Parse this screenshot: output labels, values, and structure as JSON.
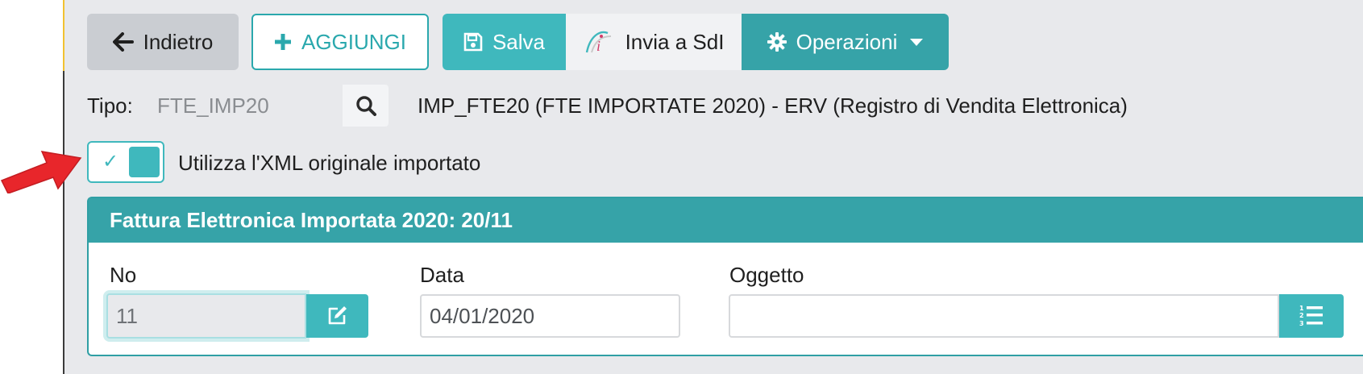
{
  "toolbar": {
    "back_label": "Indietro",
    "add_label": "AGGIUNGI",
    "save_label": "Salva",
    "send_label": "Invia a SdI",
    "operations_label": "Operazioni"
  },
  "tipo": {
    "label": "Tipo:",
    "value": "FTE_IMP20",
    "description": "IMP_FTE20 (FTE IMPORTATE 2020) - ERV (Registro di Vendita Elettronica)"
  },
  "xml_toggle": {
    "label": "Utilizza l'XML originale importato",
    "checked": true
  },
  "panel": {
    "title": "Fattura Elettronica Importata 2020: 20/11",
    "fields": {
      "no_label": "No",
      "no_value": "11",
      "data_label": "Data",
      "data_value": "04/01/2020",
      "oggetto_label": "Oggetto",
      "oggetto_value": ""
    }
  },
  "colors": {
    "accent": "#3fb8bd",
    "accent_dark": "#36a3a8",
    "background": "#e8e9ec",
    "annotation_arrow": "#e8262b"
  },
  "icons": [
    "arrow-left-icon",
    "plus-icon",
    "save-icon",
    "sdi-logo-icon",
    "gear-icon",
    "caret-down-icon",
    "search-icon",
    "check-icon",
    "edit-icon",
    "numbered-list-icon",
    "annotation-arrow"
  ]
}
